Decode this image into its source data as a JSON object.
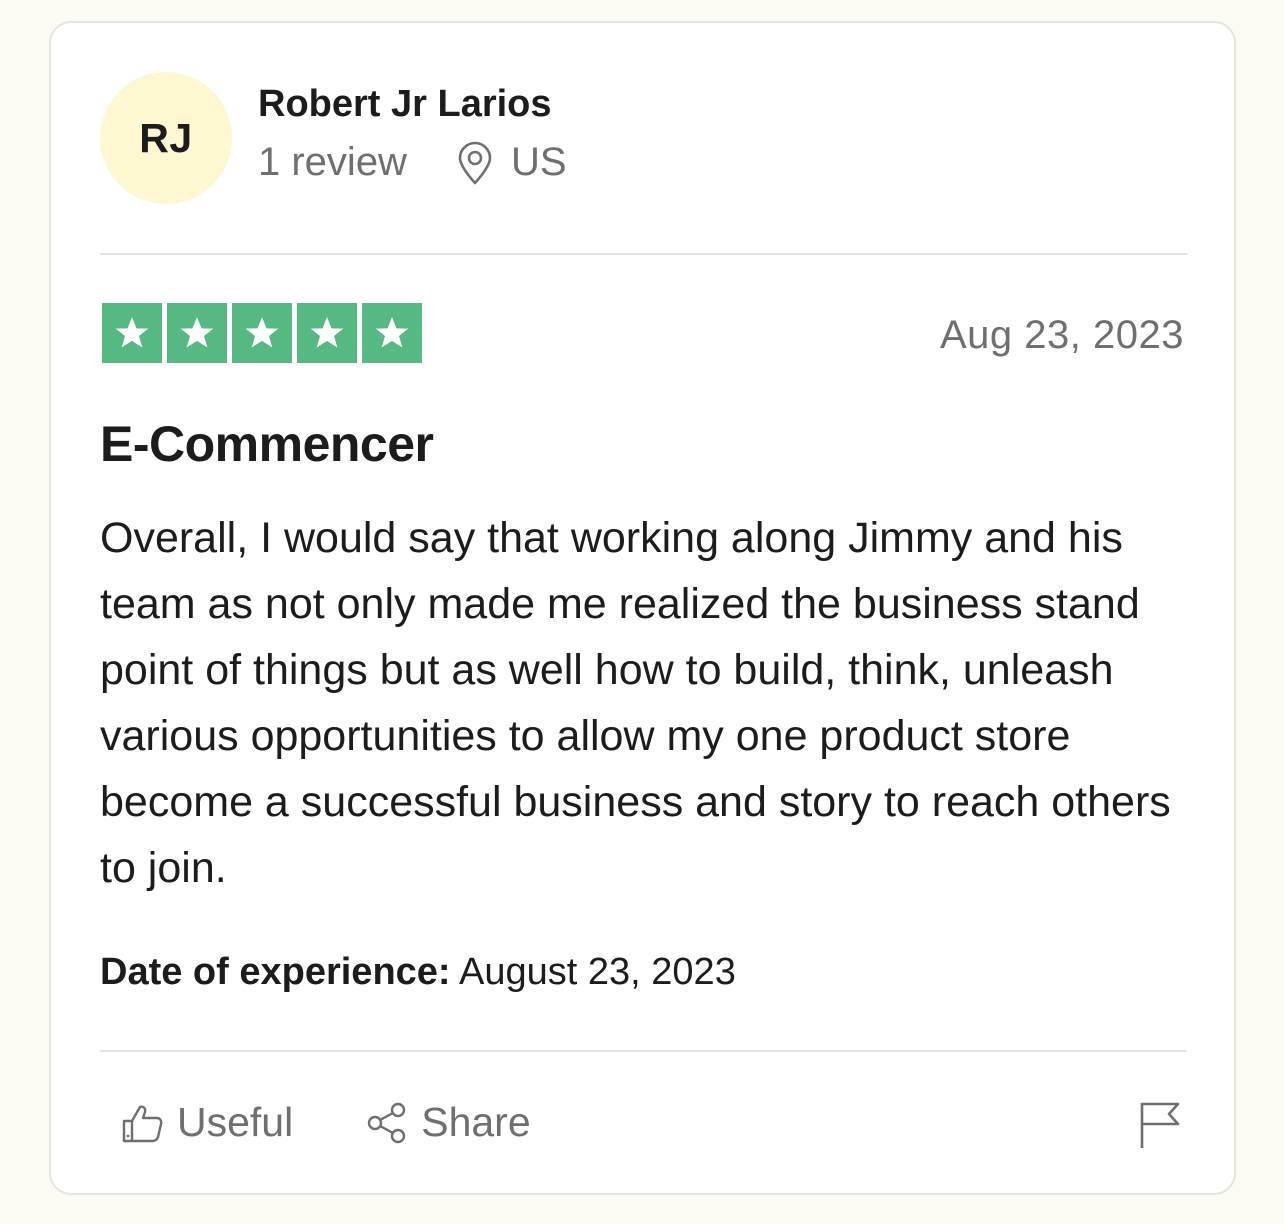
{
  "consumer": {
    "initials": "RJ",
    "name": "Robert Jr Larios",
    "review_count": "1 review",
    "country": "US",
    "avatar_color": "#fdf7d2"
  },
  "review": {
    "rating": 5,
    "rating_max": 5,
    "star_color": "#56b983",
    "date": "Aug 23, 2023",
    "title": "E-Commencer",
    "body": "Overall, I would say that working along Jimmy and his team as not only made me realized the business stand point of things but as well how to build, think, unleash various opportunities to allow my one product store become a successful business and story to reach others to join.",
    "experience_label": "Date of experience:",
    "experience_date": "August 23, 2023"
  },
  "actions": {
    "useful_label": "Useful",
    "share_label": "Share",
    "icons": [
      "thumbs-up-icon",
      "share-icon",
      "flag-icon"
    ]
  }
}
